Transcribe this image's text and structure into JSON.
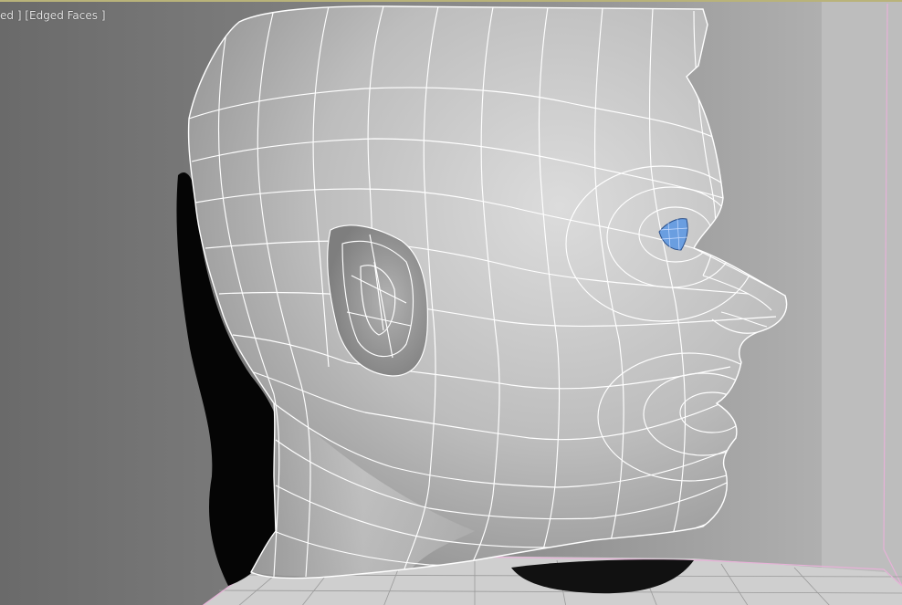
{
  "viewport": {
    "label": "ed ] [Edged Faces ]",
    "shading_mode": "Edged Faces",
    "colors": {
      "background": "#7b7b7b",
      "wall": "#bdbdbd",
      "floor": "#d2d2d2",
      "mesh_surface": "#c8c8c8",
      "mesh_wire": "#ffffff",
      "shadow": "#050505",
      "eye_selection": "#6a9ee0",
      "border_pink": "#e7b2d8",
      "border_top": "#b9b37a"
    }
  },
  "scene": {
    "object": "head-mesh",
    "selected_part": "eye",
    "view": "right-profile"
  }
}
